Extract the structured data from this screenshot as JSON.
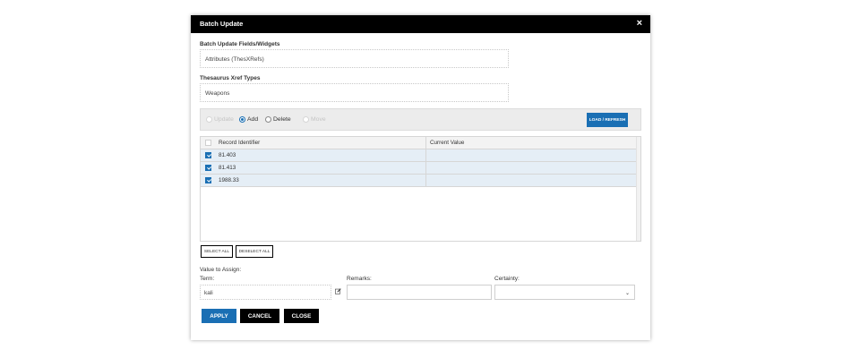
{
  "dialog": {
    "title": "Batch Update",
    "close_symbol": "×"
  },
  "fields": {
    "widgets_label": "Batch Update Fields/Widgets",
    "widgets_value": "Attributes (ThesXRefs)",
    "xref_label": "Thesaurus Xref Types",
    "xref_value": "Weapons"
  },
  "modes": {
    "options": [
      {
        "label": "Update",
        "selected": false,
        "disabled": true
      },
      {
        "label": "Add",
        "selected": true,
        "disabled": false
      },
      {
        "label": "Delete",
        "selected": false,
        "disabled": false
      },
      {
        "label": "Move",
        "selected": false,
        "disabled": true
      }
    ],
    "load_button": "LOAD / REFRESH"
  },
  "grid": {
    "columns": [
      "Record Identifier",
      "Current Value"
    ],
    "rows": [
      {
        "id": "81.403",
        "value": "",
        "checked": true
      },
      {
        "id": "81.413",
        "value": "",
        "checked": true
      },
      {
        "id": "1988.33",
        "value": "",
        "checked": true
      }
    ]
  },
  "selection": {
    "select_all": "SELECT ALL",
    "deselect_all": "DESELECT ALL"
  },
  "assign": {
    "heading": "Value to Assign:",
    "term_label": "Term:",
    "term_value": "kali",
    "remarks_label": "Remarks:",
    "remarks_value": "",
    "certainty_label": "Certainty:",
    "certainty_value": ""
  },
  "actions": {
    "apply": "APPLY",
    "cancel": "CANCEL",
    "close": "CLOSE"
  },
  "colors": {
    "accent": "#1a6fb4",
    "titlebar": "#000000",
    "row_highlight": "#e5eef6"
  },
  "icons": {
    "close": "close-icon",
    "edit": "edit-icon",
    "chevron": "chevron-down-icon",
    "check": "check-icon"
  }
}
